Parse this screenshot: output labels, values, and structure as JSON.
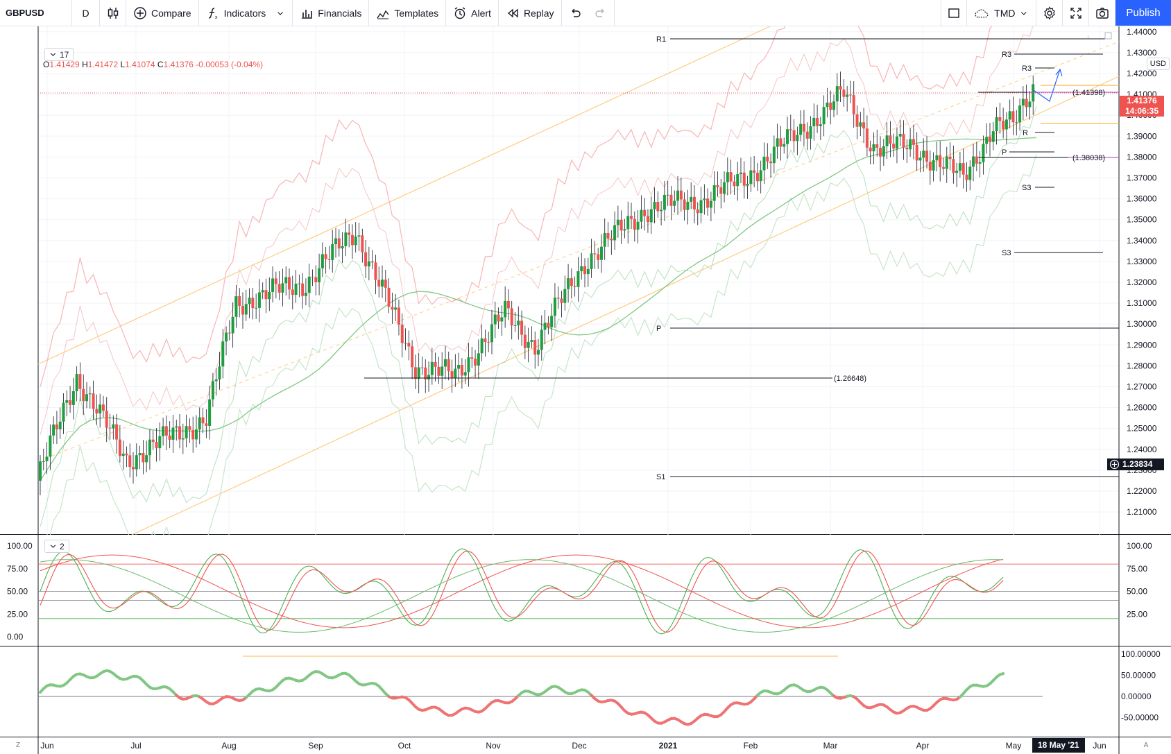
{
  "toolbar": {
    "symbol": "GBPUSD",
    "interval": "D",
    "compare_label": "Compare",
    "indicators_label": "Indicators",
    "financials_label": "Financials",
    "templates_label": "Templates",
    "alert_label": "Alert",
    "replay_label": "Replay",
    "layout_label": "TMD",
    "publish_label": "Publish"
  },
  "legend": {
    "open_key": "O",
    "open": "1.41429",
    "high_key": "H",
    "high": "1.41472",
    "low_key": "L",
    "low": "1.41074",
    "close_key": "C",
    "close": "1.41376",
    "change": "-0.00053 (-0.04%)",
    "indicators_count": "17",
    "oscillator_count": "2"
  },
  "currency": "USD",
  "price_axis": {
    "ticks": [
      "1.44000",
      "1.43000",
      "1.42000",
      "1.41000",
      "1.40000",
      "1.39000",
      "1.38000",
      "1.37000",
      "1.36000",
      "1.35000",
      "1.34000",
      "1.33000",
      "1.32000",
      "1.31000",
      "1.30000",
      "1.29000",
      "1.28000",
      "1.27000",
      "1.26000",
      "1.25000",
      "1.24000",
      "1.23000",
      "1.22000",
      "1.21000"
    ],
    "last_price": "1.41376",
    "countdown": "14:06:35",
    "crosshair_price": "1.23834"
  },
  "levels": {
    "r1": "R1",
    "p": "P",
    "s1": "S1",
    "r3_upper": "R3",
    "r3_lower": "R3",
    "s3_upper": "S3",
    "s3_lower": "S3",
    "r_small": "R",
    "p_small": "P",
    "label_high": "(1.41398)",
    "label_mid": "(1.38038)",
    "label_low": "(1.26648)"
  },
  "stoch_axis": [
    "100.00",
    "75.00",
    "50.00",
    "25.00",
    "0.00"
  ],
  "stoch_axis_right": [
    "100.00",
    "75.00",
    "50.00",
    "25.00"
  ],
  "osc_axis": [
    "100.00000",
    "50.00000",
    "0.00000",
    "-50.00000"
  ],
  "time_axis": {
    "labels": [
      "Jun",
      "Jul",
      "Aug",
      "Sep",
      "Oct",
      "Nov",
      "Dec",
      "2021",
      "Feb",
      "Mar",
      "Apr",
      "May",
      "Jun"
    ],
    "current_date": "18 May '21",
    "left_button": "Z",
    "right_button": "A"
  },
  "colors": {
    "up": "#26a69a",
    "candle_up": "#1e9e3e",
    "candle_down": "#ef5350",
    "bollinger_red": "#f5a0a0",
    "bollinger_green": "#a5d6a7",
    "channel_orange": "#ffb74d",
    "last_price_tag": "#ef5350",
    "publish": "#2962ff"
  }
}
